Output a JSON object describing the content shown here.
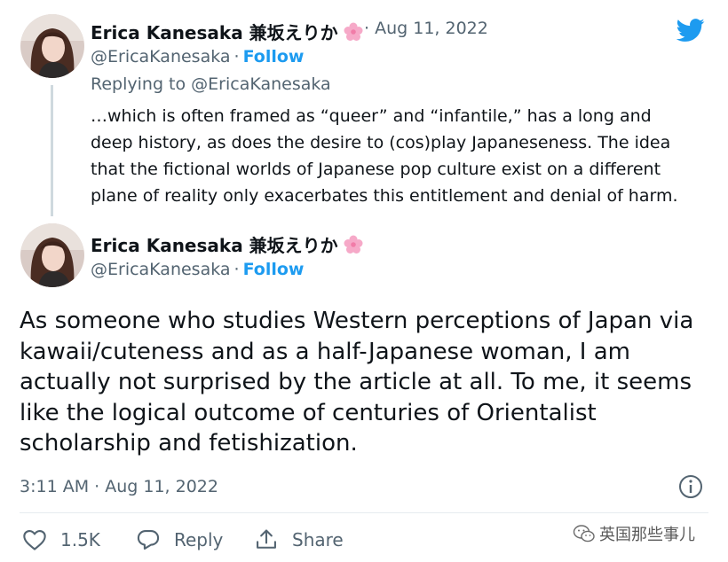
{
  "tweet1": {
    "name": "Erica Kanesaka 兼坂えりか",
    "handle": "@EricaKanesaka",
    "follow": "Follow",
    "date": "Aug 11, 2022",
    "reply_to": "Replying to @EricaKanesaka",
    "lines": [
      "…which is often framed as “queer” and “infantile,” has a long and",
      "deep history, as does the desire to (cos)play Japaneseness. The idea",
      "that the fictional worlds of Japanese pop culture exist on a different",
      "plane of reality only exacerbates this entitlement and denial of harm."
    ]
  },
  "tweet2": {
    "name": "Erica Kanesaka 兼坂えりか",
    "handle": "@EricaKanesaka",
    "follow": "Follow",
    "lines": [
      "As someone who studies Western perceptions of Japan via",
      "kawaii/cuteness and as a half-Japanese woman, I am",
      "actually not surprised by the article at all. To me, it seems",
      "like the logical outcome of centuries of Orientalist",
      "scholarship and fetishization."
    ],
    "timestamp": "3:11 AM · Aug 11, 2022"
  },
  "actions": {
    "like_count": "1.5K",
    "reply_label": "Reply",
    "share_label": "Share"
  },
  "watermark": "英国那些事儿",
  "icons": {
    "brand": "twitter-bird-icon",
    "emoji": "cherry-blossom-icon",
    "info": "info-icon",
    "like": "heart-icon",
    "reply": "reply-bubble-icon",
    "share": "share-icon",
    "watermark": "wechat-icon"
  },
  "colors": {
    "twitter_blue": "#1d9bf0",
    "secondary_text": "#536471",
    "blossom": "#f6a9c8"
  }
}
